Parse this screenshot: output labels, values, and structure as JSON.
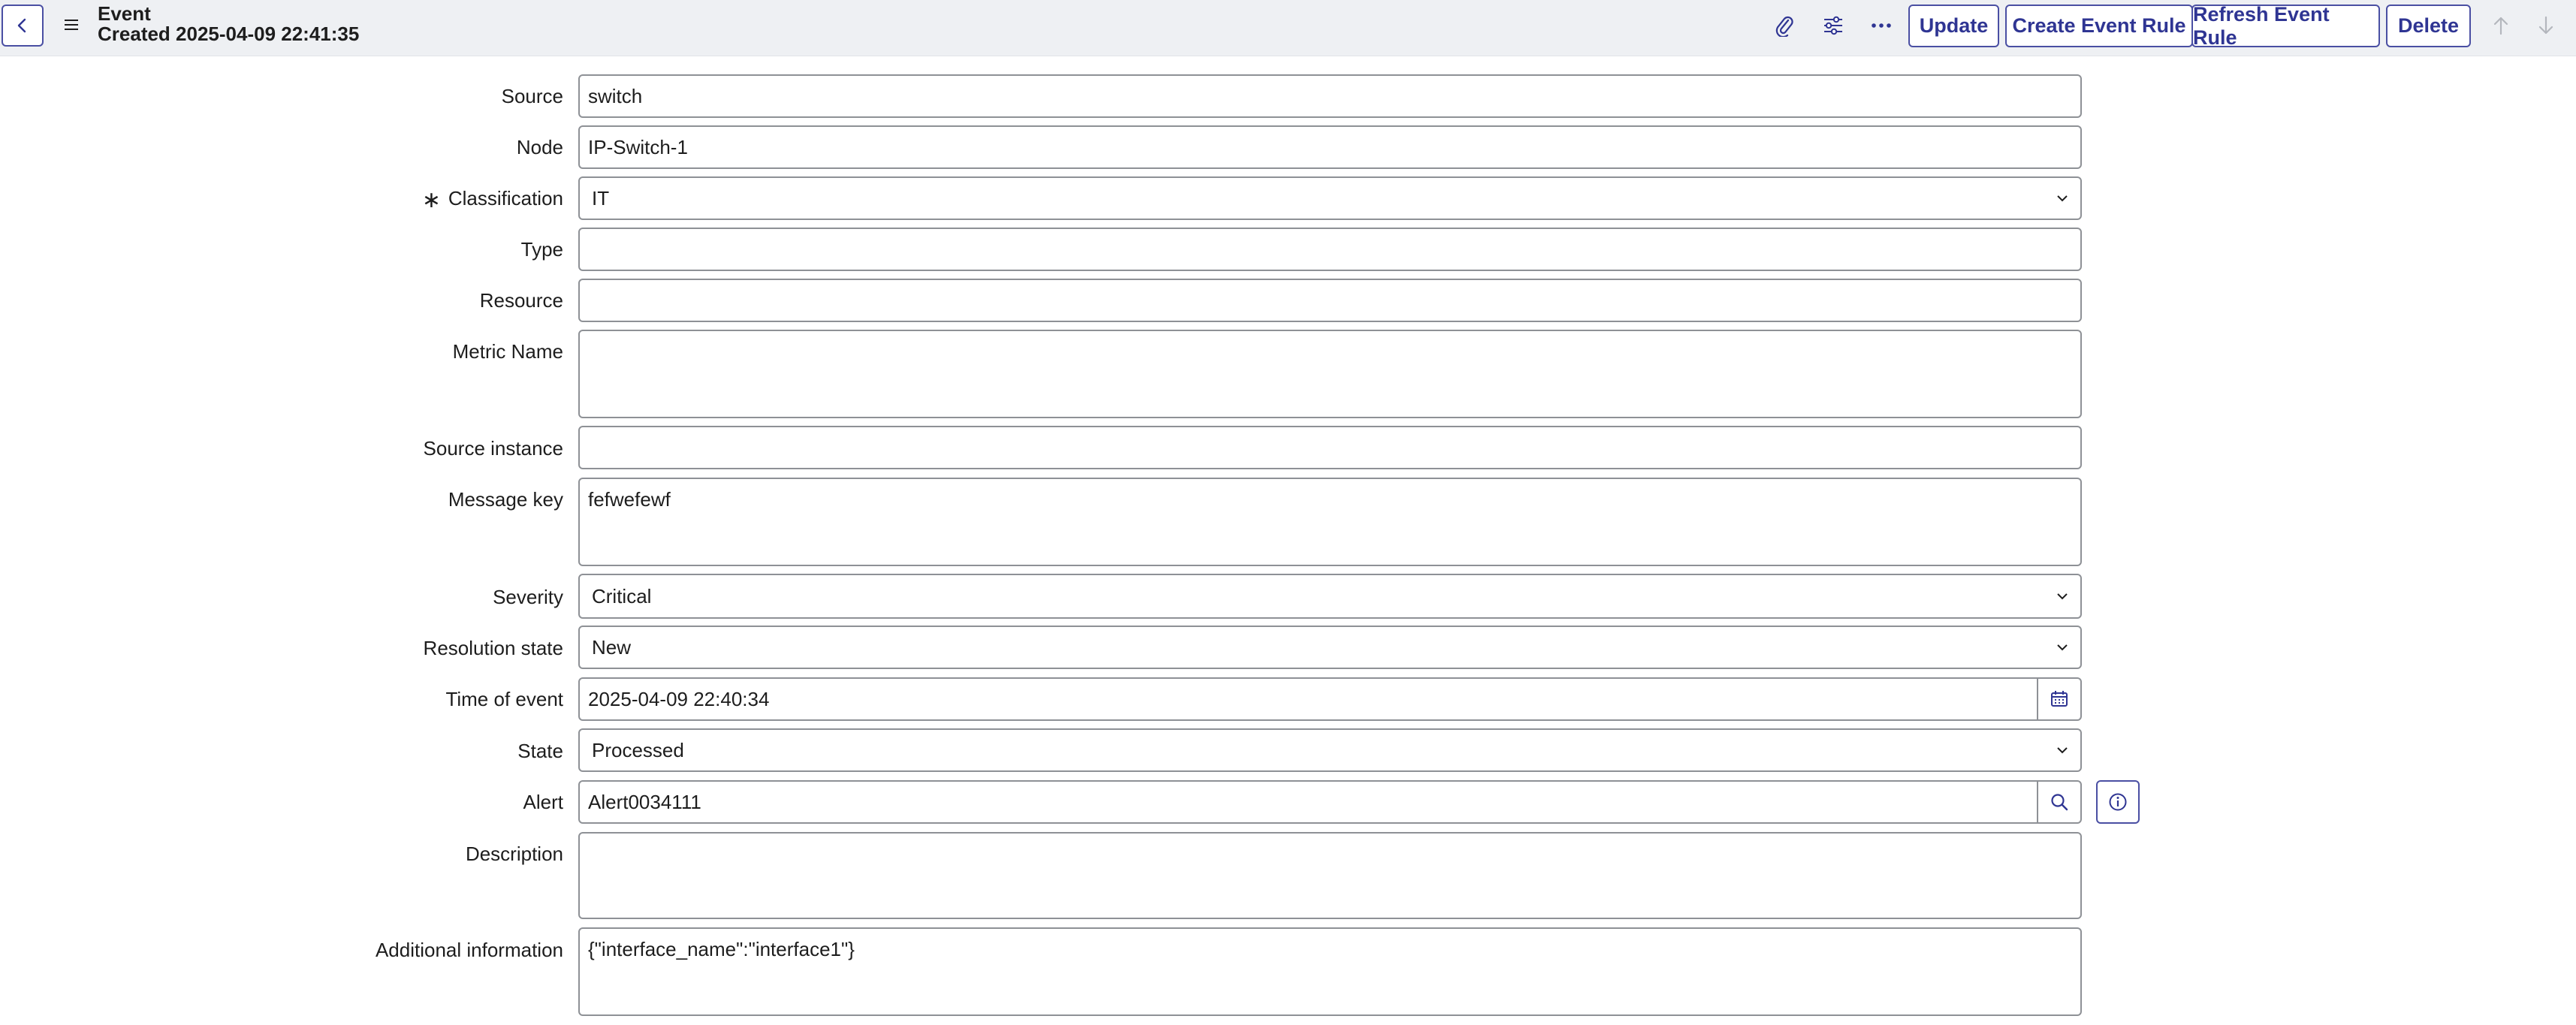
{
  "header": {
    "title": "Event",
    "subtitle": "Created 2025-04-09 22:41:35",
    "icons": [
      "back-icon",
      "menu-icon",
      "paperclip-icon",
      "sliders-icon",
      "more-icon",
      "arrow-up-icon",
      "arrow-down-icon"
    ],
    "buttons": {
      "update": "Update",
      "create_rule": "Create Event Rule",
      "refresh_rule": "Refresh Event Rule",
      "delete": "Delete"
    }
  },
  "form": {
    "source": {
      "label": "Source",
      "value": "switch"
    },
    "node": {
      "label": "Node",
      "value": "IP-Switch-1"
    },
    "classification": {
      "label": "Classification",
      "required_mark": "∗",
      "value": "IT"
    },
    "type": {
      "label": "Type",
      "value": ""
    },
    "resource": {
      "label": "Resource",
      "value": ""
    },
    "metric_name": {
      "label": "Metric Name",
      "value": ""
    },
    "source_instance": {
      "label": "Source instance",
      "value": ""
    },
    "message_key": {
      "label": "Message key",
      "value": "fefwefewf"
    },
    "severity": {
      "label": "Severity",
      "value": "Critical"
    },
    "resolution_state": {
      "label": "Resolution state",
      "value": "New"
    },
    "time_of_event": {
      "label": "Time of event",
      "value": "2025-04-09 22:40:34"
    },
    "state": {
      "label": "State",
      "value": "Processed"
    },
    "alert": {
      "label": "Alert",
      "value": "Alert0034111"
    },
    "description": {
      "label": "Description",
      "value": ""
    },
    "additional_information": {
      "label": "Additional information",
      "value": "{\"interface_name\":\"interface1\"}"
    }
  },
  "colors": {
    "header_bg": "#eef0f3",
    "accent": "#2f3593",
    "border": "#8e9196"
  }
}
